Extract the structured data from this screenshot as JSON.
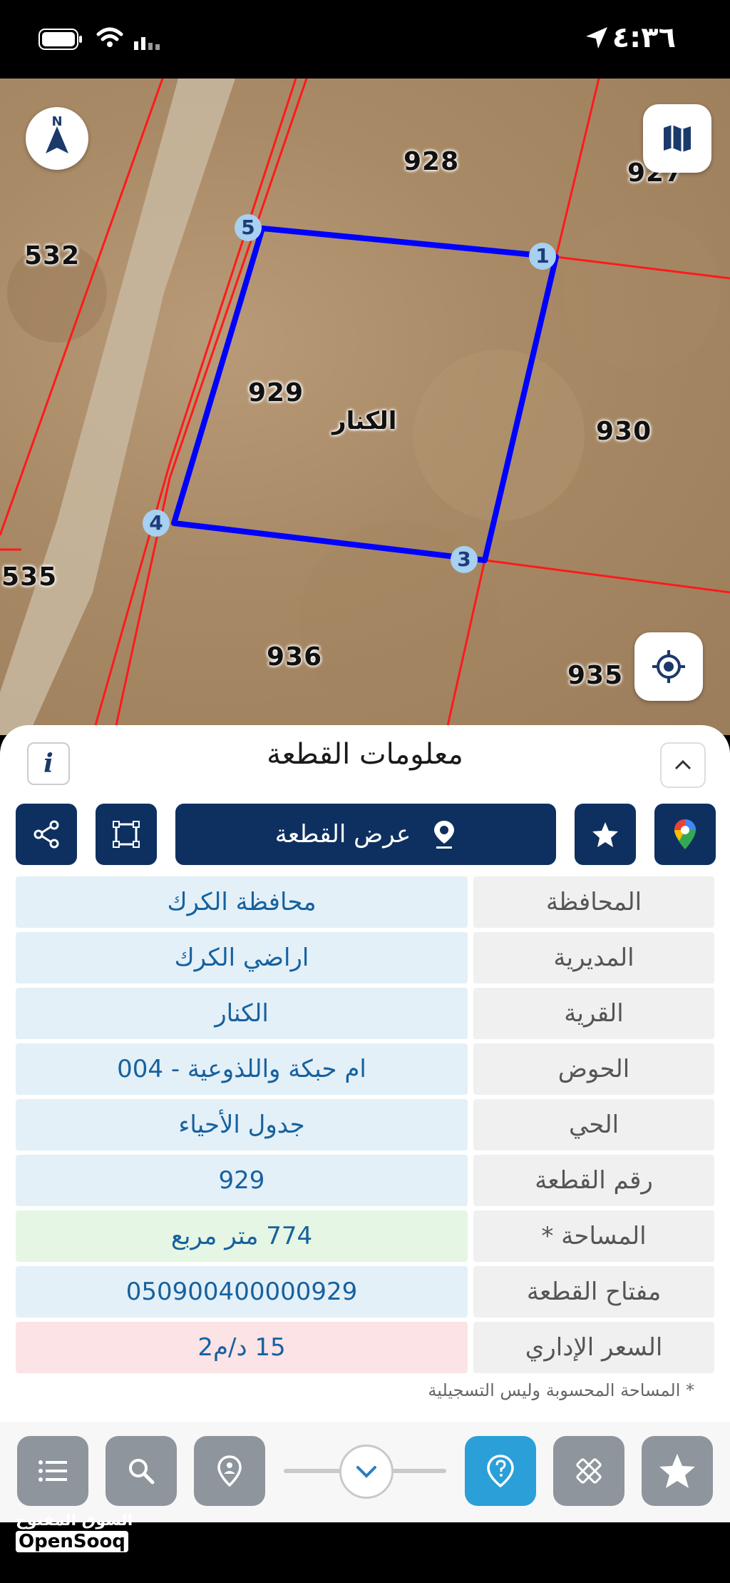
{
  "status_bar": {
    "time": "٤:٣٦"
  },
  "map": {
    "parcel_numbers": [
      "928",
      "927",
      "532",
      "929",
      "930",
      "535",
      "936",
      "935"
    ],
    "village_label": "الكنار",
    "vertices": [
      "1",
      "3",
      "4",
      "5"
    ],
    "colors": {
      "boundary": "#0000ff",
      "parcel_lines": "#ff0000"
    }
  },
  "panel": {
    "title": "معلومات القطعة",
    "show_parcel_label": "عرض القطعة",
    "info_label": "i",
    "rows": [
      {
        "key": "المحافظة",
        "value": "محافظة الكرك"
      },
      {
        "key": "المديرية",
        "value": "اراضي الكرك"
      },
      {
        "key": "القرية",
        "value": "الكنار"
      },
      {
        "key": "الحوض",
        "value": "ام حبكة واللذوعية - 004"
      },
      {
        "key": "الحي",
        "value": "جدول الأحياء"
      },
      {
        "key": "رقم القطعة",
        "value": "929"
      },
      {
        "key": "المساحة *",
        "value": "774  متر مربع"
      },
      {
        "key": "مفتاح القطعة",
        "value": "050900400000929"
      },
      {
        "key": "السعر الإداري",
        "value": "15 د/م2"
      }
    ],
    "footnote": "* المساحة المحسوبة وليس التسجيلية"
  },
  "watermark": {
    "arabic": "السوق المفتوح",
    "english": "OpenSooq"
  },
  "colors": {
    "primary_dark": "#0e3060",
    "value_text": "#17619e",
    "area_row_bg": "#e6f6e4",
    "price_row_bg": "#fbe3e6",
    "active_tool": "#2b9fd8"
  }
}
